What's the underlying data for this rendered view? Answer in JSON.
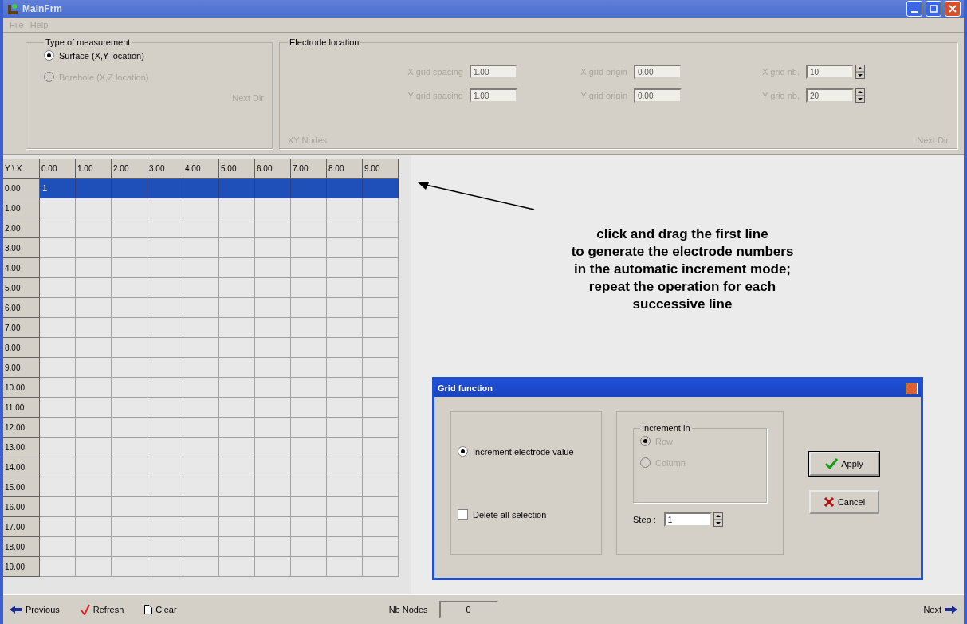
{
  "window": {
    "title": "MainFrm"
  },
  "menu": [
    {
      "label": "File",
      "disabled": true
    },
    {
      "label": "Help",
      "disabled": true
    }
  ],
  "measurement": {
    "title": "Type of measurement",
    "options": [
      {
        "label": "Surface (X,Y location)",
        "selected": true,
        "disabled": false
      },
      {
        "label": "Borehole (X,Z location)",
        "selected": false,
        "disabled": true
      }
    ],
    "next_button": "Next Dir"
  },
  "electrode_location": {
    "title": "Electrode location",
    "note": "XY Nodes",
    "fields": [
      {
        "label": "X grid spacing",
        "value": "1.00",
        "kind": "text"
      },
      {
        "label": "X grid origin",
        "value": "0.00",
        "kind": "text"
      },
      {
        "label": "X grid nb.",
        "value": "10",
        "kind": "spin"
      },
      {
        "label": "Y grid spacing",
        "value": "1.00",
        "kind": "text"
      },
      {
        "label": "Y grid origin",
        "value": "0.00",
        "kind": "text"
      },
      {
        "label": "Y grid nb.",
        "value": "20",
        "kind": "spin"
      }
    ],
    "next_button": "Next Dir"
  },
  "grid": {
    "corner": "Y \\ X",
    "columns": [
      "0.00",
      "1.00",
      "2.00",
      "3.00",
      "4.00",
      "5.00",
      "6.00",
      "7.00",
      "8.00",
      "9.00"
    ],
    "rows": [
      {
        "label": "0.00",
        "selected": true,
        "first_value": "1"
      },
      {
        "label": "1.00",
        "selected": false
      },
      {
        "label": "2.00",
        "selected": false
      },
      {
        "label": "3.00",
        "selected": false
      },
      {
        "label": "4.00",
        "selected": false
      },
      {
        "label": "5.00",
        "selected": false
      },
      {
        "label": "6.00",
        "selected": false
      },
      {
        "label": "7.00",
        "selected": false
      },
      {
        "label": "8.00",
        "selected": false
      },
      {
        "label": "9.00",
        "selected": false
      },
      {
        "label": "10.00",
        "selected": false
      },
      {
        "label": "11.00",
        "selected": false
      },
      {
        "label": "12.00",
        "selected": false
      },
      {
        "label": "13.00",
        "selected": false
      },
      {
        "label": "14.00",
        "selected": false
      },
      {
        "label": "15.00",
        "selected": false
      },
      {
        "label": "16.00",
        "selected": false
      },
      {
        "label": "17.00",
        "selected": false
      },
      {
        "label": "18.00",
        "selected": false
      },
      {
        "label": "19.00",
        "selected": false
      }
    ]
  },
  "annotation": [
    "click and drag the first line",
    "to generate the electrode numbers",
    "in the automatic increment mode;",
    "repeat the operation for each",
    "successive line"
  ],
  "dialog": {
    "title": "Grid function",
    "options": [
      {
        "label": "Increment electrode value",
        "kind": "radio",
        "selected": true
      },
      {
        "label": "Delete all selection",
        "kind": "checkbox",
        "selected": false
      }
    ],
    "increment": {
      "title": "Increment in",
      "options": [
        {
          "label": "Row",
          "selected": true,
          "disabled": true
        },
        {
          "label": "Column",
          "selected": false,
          "disabled": true
        }
      ]
    },
    "step": {
      "label": "Step :",
      "value": "1"
    },
    "apply_button": "Apply",
    "cancel_button": "Cancel"
  },
  "status_bar": {
    "previous": "Previous",
    "refresh": "Refresh",
    "clear": "Clear",
    "nodes_label": "Nb Nodes",
    "nodes_value": "0",
    "next": "Next"
  }
}
